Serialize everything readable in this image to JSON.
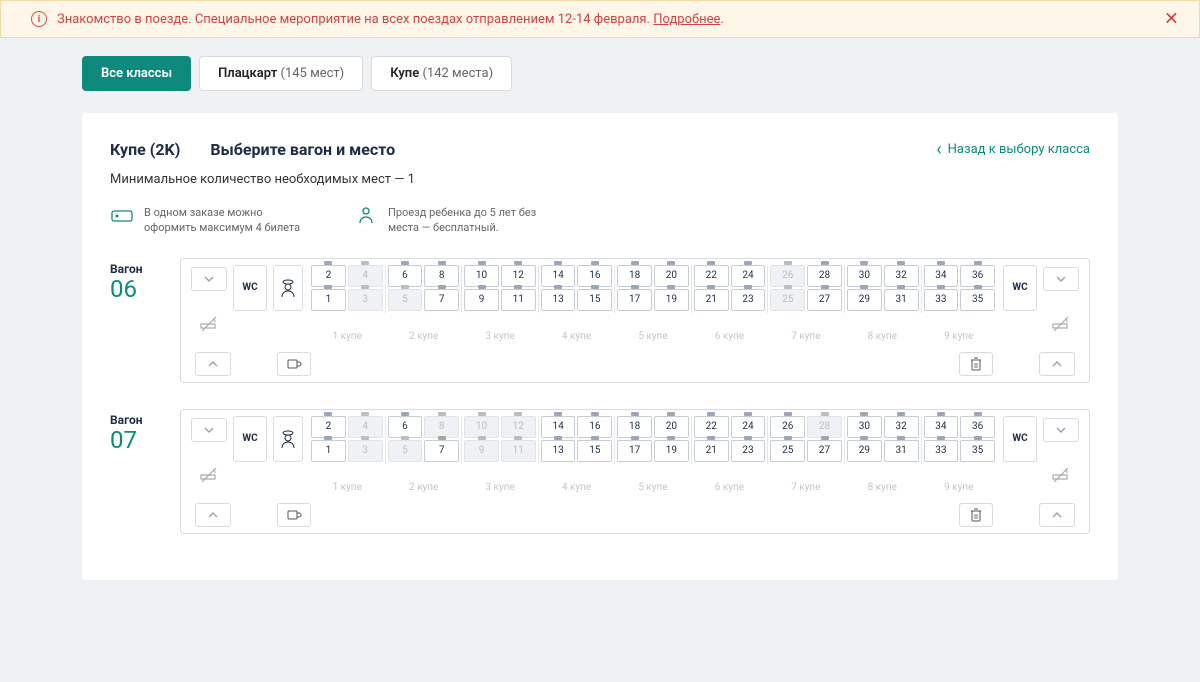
{
  "banner": {
    "text_prefix": "Знакомство в поезде. Специальное мероприятие на всех поездах отправлением 12-14 февраля.",
    "link_text": "Подробнее",
    "dot": "."
  },
  "tabs": {
    "all": "Все классы",
    "platzkart_label": "Плацкарт",
    "platzkart_count": "(145 мест)",
    "kupe_label": "Купе",
    "kupe_count": "(142 места)"
  },
  "header": {
    "class_title": "Купе (2K)",
    "instruction": "Выберите вагон и место",
    "back_link": "Назад к выбору класса",
    "min_seats": "Минимальное количество необходимых мест — 1"
  },
  "info": {
    "tickets": "В одном заказе можно оформить максимум 4 билета",
    "child": "Проезд ребенка до 5 лет без места — бесплатный."
  },
  "wagon_label": "Вагон",
  "wc_label": "WC",
  "coupe_label_prefix": "купе",
  "wagons": [
    {
      "number": "06",
      "coupes": [
        {
          "upper": [
            {
              "n": 2,
              "a": true
            },
            {
              "n": 4,
              "a": false
            }
          ],
          "lower": [
            {
              "n": 1,
              "a": true
            },
            {
              "n": 3,
              "a": false
            }
          ]
        },
        {
          "upper": [
            {
              "n": 6,
              "a": true
            },
            {
              "n": 8,
              "a": true
            }
          ],
          "lower": [
            {
              "n": 5,
              "a": false
            },
            {
              "n": 7,
              "a": true
            }
          ]
        },
        {
          "upper": [
            {
              "n": 10,
              "a": true
            },
            {
              "n": 12,
              "a": true
            }
          ],
          "lower": [
            {
              "n": 9,
              "a": true
            },
            {
              "n": 11,
              "a": true
            }
          ]
        },
        {
          "upper": [
            {
              "n": 14,
              "a": true
            },
            {
              "n": 16,
              "a": true
            }
          ],
          "lower": [
            {
              "n": 13,
              "a": true
            },
            {
              "n": 15,
              "a": true
            }
          ]
        },
        {
          "upper": [
            {
              "n": 18,
              "a": true
            },
            {
              "n": 20,
              "a": true
            }
          ],
          "lower": [
            {
              "n": 17,
              "a": true
            },
            {
              "n": 19,
              "a": true
            }
          ]
        },
        {
          "upper": [
            {
              "n": 22,
              "a": true
            },
            {
              "n": 24,
              "a": true
            }
          ],
          "lower": [
            {
              "n": 21,
              "a": true
            },
            {
              "n": 23,
              "a": true
            }
          ]
        },
        {
          "upper": [
            {
              "n": 26,
              "a": false
            },
            {
              "n": 28,
              "a": true
            }
          ],
          "lower": [
            {
              "n": 25,
              "a": false
            },
            {
              "n": 27,
              "a": true
            }
          ]
        },
        {
          "upper": [
            {
              "n": 30,
              "a": true
            },
            {
              "n": 32,
              "a": true
            }
          ],
          "lower": [
            {
              "n": 29,
              "a": true
            },
            {
              "n": 31,
              "a": true
            }
          ]
        },
        {
          "upper": [
            {
              "n": 34,
              "a": true
            },
            {
              "n": 36,
              "a": true
            }
          ],
          "lower": [
            {
              "n": 33,
              "a": true
            },
            {
              "n": 35,
              "a": true
            }
          ]
        }
      ]
    },
    {
      "number": "07",
      "coupes": [
        {
          "upper": [
            {
              "n": 2,
              "a": true
            },
            {
              "n": 4,
              "a": false
            }
          ],
          "lower": [
            {
              "n": 1,
              "a": true
            },
            {
              "n": 3,
              "a": false
            }
          ]
        },
        {
          "upper": [
            {
              "n": 6,
              "a": true
            },
            {
              "n": 8,
              "a": false
            }
          ],
          "lower": [
            {
              "n": 5,
              "a": false
            },
            {
              "n": 7,
              "a": true
            }
          ]
        },
        {
          "upper": [
            {
              "n": 10,
              "a": false
            },
            {
              "n": 12,
              "a": false
            }
          ],
          "lower": [
            {
              "n": 9,
              "a": false
            },
            {
              "n": 11,
              "a": false
            }
          ]
        },
        {
          "upper": [
            {
              "n": 14,
              "a": true
            },
            {
              "n": 16,
              "a": true
            }
          ],
          "lower": [
            {
              "n": 13,
              "a": true
            },
            {
              "n": 15,
              "a": true
            }
          ]
        },
        {
          "upper": [
            {
              "n": 18,
              "a": true
            },
            {
              "n": 20,
              "a": true
            }
          ],
          "lower": [
            {
              "n": 17,
              "a": true
            },
            {
              "n": 19,
              "a": true
            }
          ]
        },
        {
          "upper": [
            {
              "n": 22,
              "a": true
            },
            {
              "n": 24,
              "a": true
            }
          ],
          "lower": [
            {
              "n": 21,
              "a": true
            },
            {
              "n": 23,
              "a": true
            }
          ]
        },
        {
          "upper": [
            {
              "n": 26,
              "a": true
            },
            {
              "n": 28,
              "a": false
            }
          ],
          "lower": [
            {
              "n": 25,
              "a": true
            },
            {
              "n": 27,
              "a": true
            }
          ]
        },
        {
          "upper": [
            {
              "n": 30,
              "a": true
            },
            {
              "n": 32,
              "a": true
            }
          ],
          "lower": [
            {
              "n": 29,
              "a": true
            },
            {
              "n": 31,
              "a": true
            }
          ]
        },
        {
          "upper": [
            {
              "n": 34,
              "a": true
            },
            {
              "n": 36,
              "a": true
            }
          ],
          "lower": [
            {
              "n": 33,
              "a": true
            },
            {
              "n": 35,
              "a": true
            }
          ]
        }
      ]
    }
  ]
}
